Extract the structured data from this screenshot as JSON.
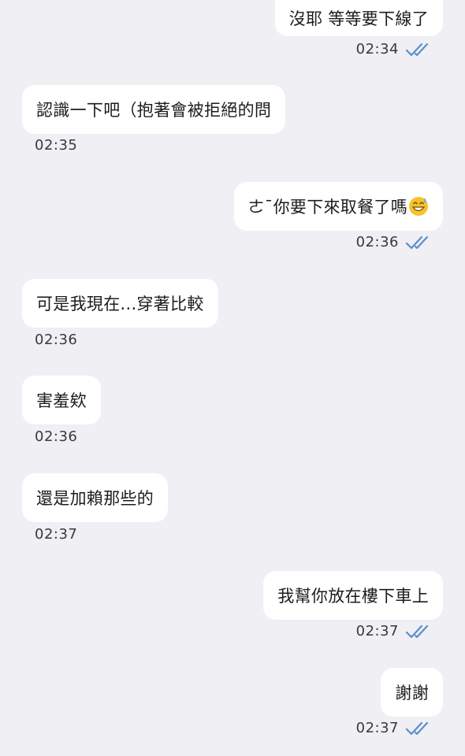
{
  "messages": [
    {
      "side": "out",
      "text": "沒耶 等等要下線了",
      "time": "02:34",
      "read": true
    },
    {
      "side": "in",
      "text": "認識一下吧（抱著會被拒絕的問",
      "time": "02:35"
    },
    {
      "side": "out",
      "text": "ㄜˉ你要下來取餐了嗎",
      "emoji": "grinning-sweat-emoji",
      "time": "02:36",
      "read": true
    },
    {
      "side": "in",
      "text": "可是我現在...穿著比較",
      "time": "02:36"
    },
    {
      "side": "in",
      "text": "害羞欸",
      "time": "02:36"
    },
    {
      "side": "in",
      "text": "還是加賴那些的",
      "time": "02:37"
    },
    {
      "side": "out",
      "text": "我幫你放在樓下車上",
      "time": "02:37",
      "read": true
    },
    {
      "side": "out",
      "text": "謝謝",
      "time": "02:37",
      "read": true
    }
  ],
  "colors": {
    "background": "#efeff4",
    "bubble": "#ffffff",
    "read_check": "#5b8fc9",
    "text": "#1c1c1e",
    "time": "#3a3a3c"
  },
  "icons": {
    "read_receipt": "double-check-icon"
  }
}
